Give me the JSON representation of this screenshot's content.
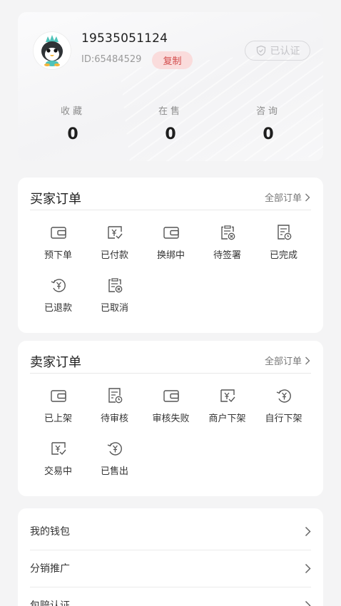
{
  "profile": {
    "phone": "19535051124",
    "id_text": "ID:65484529",
    "copy_label": "复制",
    "verified_label": "已认证",
    "stats": [
      {
        "label": "收藏",
        "value": "0"
      },
      {
        "label": "在售",
        "value": "0"
      },
      {
        "label": "咨询",
        "value": "0"
      }
    ]
  },
  "buyer_orders": {
    "title": "买家订单",
    "all_link": "全部订单",
    "items": [
      {
        "label": "预下单",
        "icon": "wallet-icon"
      },
      {
        "label": "已付款",
        "icon": "yen-check-icon"
      },
      {
        "label": "换绑中",
        "icon": "wallet-icon"
      },
      {
        "label": "待签署",
        "icon": "clipboard-x-icon"
      },
      {
        "label": "已完成",
        "icon": "document-clock-icon"
      },
      {
        "label": "已退款",
        "icon": "yen-refund-icon"
      },
      {
        "label": "已取消",
        "icon": "clipboard-x-icon"
      }
    ]
  },
  "seller_orders": {
    "title": "卖家订单",
    "all_link": "全部订单",
    "items": [
      {
        "label": "已上架",
        "icon": "wallet-icon"
      },
      {
        "label": "待审核",
        "icon": "document-clock-icon"
      },
      {
        "label": "审核失败",
        "icon": "wallet-icon"
      },
      {
        "label": "商户下架",
        "icon": "yen-check-icon"
      },
      {
        "label": "自行下架",
        "icon": "yen-refund-icon"
      },
      {
        "label": "交易中",
        "icon": "yen-check-icon"
      },
      {
        "label": "已售出",
        "icon": "yen-refund-icon"
      }
    ]
  },
  "menu": [
    {
      "label": "我的钱包"
    },
    {
      "label": "分销推广"
    },
    {
      "label": "包赔认证"
    }
  ],
  "colors": {
    "accent_red": "#d24b4b",
    "copy_bg": "#fadcdc",
    "avatar_teal": "#4fc3b9"
  }
}
